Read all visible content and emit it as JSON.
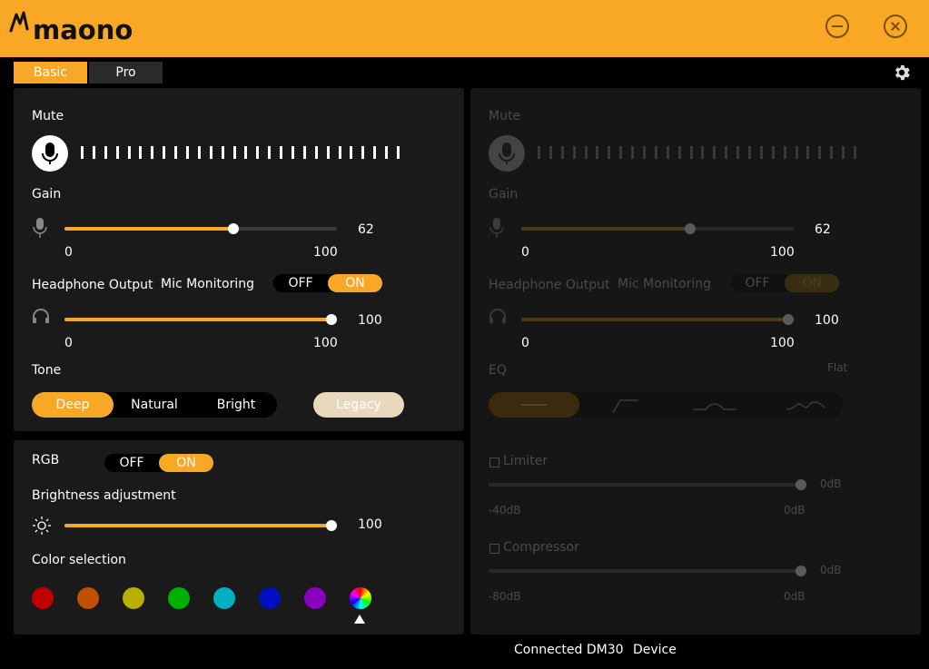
{
  "app": {
    "brand": "maono",
    "accent": "#f9a825"
  },
  "tabs": [
    {
      "label": "Basic",
      "active": true
    },
    {
      "label": "Pro",
      "active": false
    }
  ],
  "basic": {
    "mute_label": "Mute",
    "gain": {
      "label": "Gain",
      "value": "62",
      "min": "0",
      "max": "100",
      "level": 0.62
    },
    "headphone": {
      "label": "Headphone Output",
      "value": "100",
      "min": "0",
      "max": "100",
      "level": 1.0
    },
    "mic_monitoring": {
      "label": "Mic Monitoring",
      "off": "OFF",
      "on": "ON",
      "state": "on"
    },
    "tone": {
      "label": "Tone",
      "options": [
        "Deep",
        "Natural",
        "Bright"
      ],
      "selected": "Deep",
      "legacy": "Legacy"
    }
  },
  "rgb": {
    "label": "RGB",
    "off": "OFF",
    "on": "ON",
    "state": "on",
    "brightness": {
      "label": "Brightness adjustment",
      "value": "100",
      "level": 1.0
    },
    "color_label": "Color selection",
    "colors": [
      "#c00000",
      "#c05000",
      "#b8b000",
      "#00b000",
      "#00b0c0",
      "#0010c0",
      "#8800c0",
      "rainbow"
    ],
    "selected_color": 7
  },
  "pro": {
    "mute_label": "Mute",
    "gain": {
      "label": "Gain",
      "value": "62",
      "min": "0",
      "max": "100",
      "level": 0.62
    },
    "headphone": {
      "label": "Headphone Output",
      "value": "100",
      "min": "0",
      "max": "100",
      "level": 1.0
    },
    "mic_monitoring": {
      "label": "Mic Monitoring",
      "off": "OFF",
      "on": "ON"
    },
    "eq": {
      "label": "EQ",
      "preset": "Flat"
    },
    "limiter": {
      "label": "Limiter",
      "value": "0dB",
      "min": "-40dB",
      "max": "0dB"
    },
    "compressor": {
      "label": "Compressor",
      "value": "0dB",
      "min": "-80dB",
      "max": "0dB"
    }
  },
  "status": {
    "prefix": "Connected",
    "device": "DM30",
    "suffix": "Device"
  }
}
